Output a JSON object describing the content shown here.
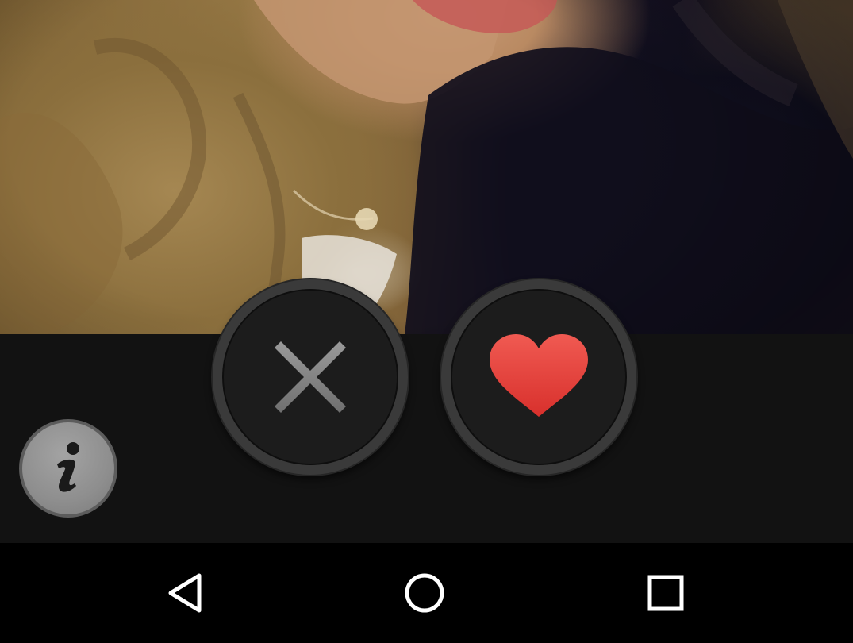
{
  "profile": {
    "photo_subject": "profile photo"
  },
  "actions": {
    "dislike_icon": "close-x-icon",
    "like_icon": "heart-icon",
    "info_icon": "info-icon"
  },
  "colors": {
    "heart": "#e8403c",
    "x_mark": "#8a8a8a",
    "action_bar_bg": "#121212",
    "nav_bar_bg": "#000000"
  },
  "nav_bar": {
    "back_icon": "back-triangle-icon",
    "home_icon": "home-circle-icon",
    "recents_icon": "recents-square-icon"
  }
}
